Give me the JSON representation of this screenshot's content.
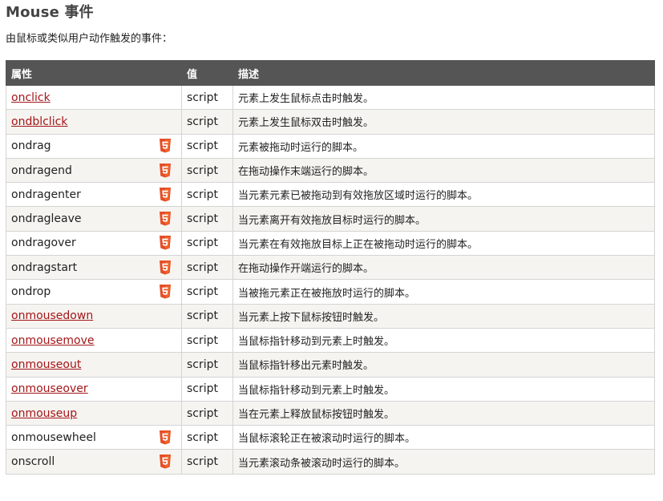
{
  "page": {
    "title": "Mouse 事件",
    "intro": "由鼠标或类似用户动作触发的事件："
  },
  "table": {
    "headers": [
      "属性",
      "值",
      "描述"
    ],
    "rows": [
      {
        "attr": "onclick",
        "link": true,
        "html5": false,
        "value": "script",
        "desc": "元素上发生鼠标点击时触发。"
      },
      {
        "attr": "ondblclick",
        "link": true,
        "html5": false,
        "value": "script",
        "desc": "元素上发生鼠标双击时触发。"
      },
      {
        "attr": "ondrag",
        "link": false,
        "html5": true,
        "value": "script",
        "desc": "元素被拖动时运行的脚本。"
      },
      {
        "attr": "ondragend",
        "link": false,
        "html5": true,
        "value": "script",
        "desc": "在拖动操作末端运行的脚本。"
      },
      {
        "attr": "ondragenter",
        "link": false,
        "html5": true,
        "value": "script",
        "desc": "当元素元素已被拖动到有效拖放区域时运行的脚本。"
      },
      {
        "attr": "ondragleave",
        "link": false,
        "html5": true,
        "value": "script",
        "desc": "当元素离开有效拖放目标时运行的脚本。"
      },
      {
        "attr": "ondragover",
        "link": false,
        "html5": true,
        "value": "script",
        "desc": "当元素在有效拖放目标上正在被拖动时运行的脚本。"
      },
      {
        "attr": "ondragstart",
        "link": false,
        "html5": true,
        "value": "script",
        "desc": "在拖动操作开端运行的脚本。"
      },
      {
        "attr": "ondrop",
        "link": false,
        "html5": true,
        "value": "script",
        "desc": "当被拖元素正在被拖放时运行的脚本。"
      },
      {
        "attr": "onmousedown",
        "link": true,
        "html5": false,
        "value": "script",
        "desc": "当元素上按下鼠标按钮时触发。"
      },
      {
        "attr": "onmousemove",
        "link": true,
        "html5": false,
        "value": "script",
        "desc": "当鼠标指针移动到元素上时触发。"
      },
      {
        "attr": "onmouseout",
        "link": true,
        "html5": false,
        "value": "script",
        "desc": "当鼠标指针移出元素时触发。"
      },
      {
        "attr": "onmouseover",
        "link": true,
        "html5": false,
        "value": "script",
        "desc": "当鼠标指针移动到元素上时触发。"
      },
      {
        "attr": "onmouseup",
        "link": true,
        "html5": false,
        "value": "script",
        "desc": "当在元素上释放鼠标按钮时触发。"
      },
      {
        "attr": "onmousewheel",
        "link": false,
        "html5": true,
        "value": "script",
        "desc": "当鼠标滚轮正在被滚动时运行的脚本。"
      },
      {
        "attr": "onscroll",
        "link": false,
        "html5": true,
        "value": "script",
        "desc": "当元素滚动条被滚动时运行的脚本。"
      }
    ]
  },
  "icons": {
    "html5_badge": "html5-icon",
    "html5_color": "#e44d26"
  },
  "colors": {
    "header_bg": "#555555",
    "link": "#a4161a",
    "row_alt": "#f6f4f0"
  }
}
